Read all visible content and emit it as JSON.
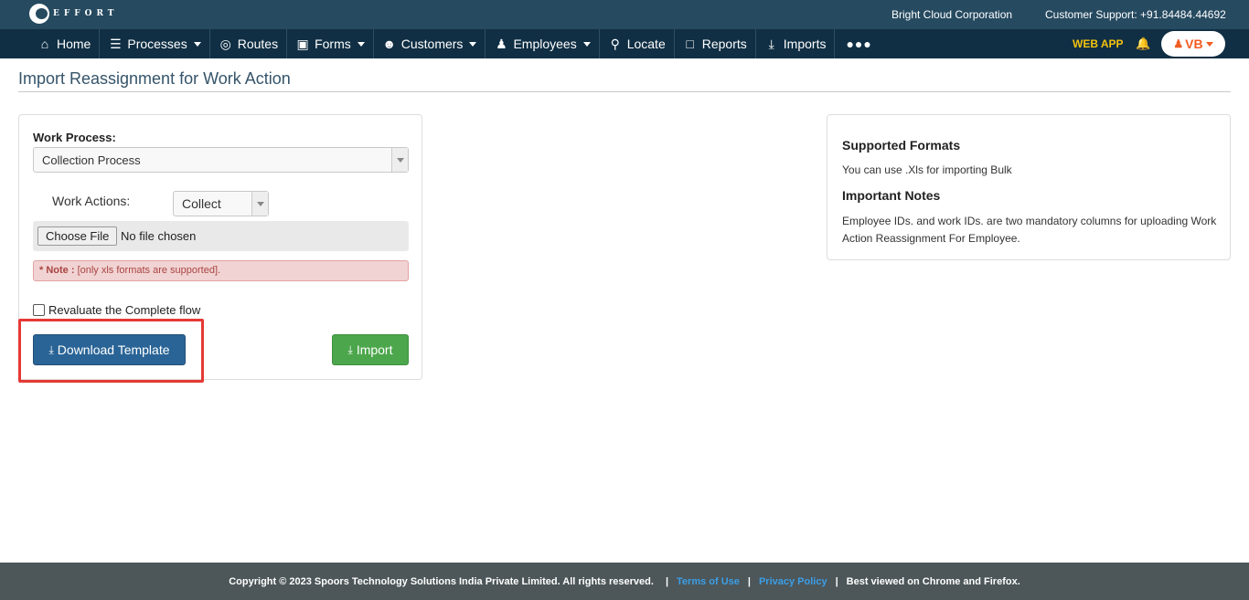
{
  "topbar": {
    "logo_text": "EFFORT",
    "organization": "Bright Cloud Corporation",
    "support": "Customer Support: +91.84484.44692"
  },
  "nav": {
    "items": [
      {
        "label": "Home",
        "icon": "home-icon"
      },
      {
        "label": "Processes",
        "icon": "list-icon"
      },
      {
        "label": "Routes",
        "icon": "target-icon"
      },
      {
        "label": "Forms",
        "icon": "document-icon"
      },
      {
        "label": "Customers",
        "icon": "users-icon"
      },
      {
        "label": "Employees",
        "icon": "user-icon"
      },
      {
        "label": "Locate",
        "icon": "map-pin-icon"
      },
      {
        "label": "Reports",
        "icon": "report-icon"
      },
      {
        "label": "Imports",
        "icon": "download-icon"
      }
    ],
    "more": "●●●",
    "web_app": "WEB APP",
    "user_initials": "VB"
  },
  "page": {
    "title": "Import Reassignment for Work Action"
  },
  "form": {
    "work_process_label": "Work Process:",
    "work_process_value": "Collection Process",
    "work_actions_label": "Work Actions:",
    "work_actions_value": "Collect",
    "choose_file_label": "Choose File",
    "file_status": "No file chosen",
    "note_label": "* Note :",
    "note_text": "[only xls formats are supported].",
    "checkbox_label": "Revaluate the Complete flow",
    "download_label": "Download Template",
    "import_label": "Import"
  },
  "info": {
    "supported_heading": "Supported Formats",
    "supported_text": "You can use .Xls for importing Bulk",
    "notes_heading": "Important Notes",
    "notes_text": "Employee IDs. and work IDs. are two mandatory columns for uploading Work Action Reassignment For Employee."
  },
  "footer": {
    "copyright": "Copyright © 2023 Spoors Technology Solutions India Private Limited. All rights reserved.",
    "terms": "Terms of Use",
    "privacy": "Privacy Policy",
    "best_viewed": "Best viewed on Chrome and Firefox.",
    "separator": "|"
  },
  "colors": {
    "topbar": "#264a60",
    "nav": "#102f44",
    "download_button": "#2a6496",
    "import_button": "#4ca64c",
    "highlight": "#e53935"
  }
}
